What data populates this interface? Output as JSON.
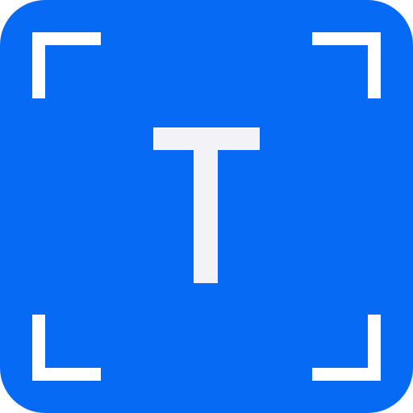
{
  "icon": {
    "name": "text-recognition-icon",
    "colors": {
      "background": "#076AF5",
      "frame": "#FFFFFF",
      "glyph": "#F2F2F7"
    }
  }
}
